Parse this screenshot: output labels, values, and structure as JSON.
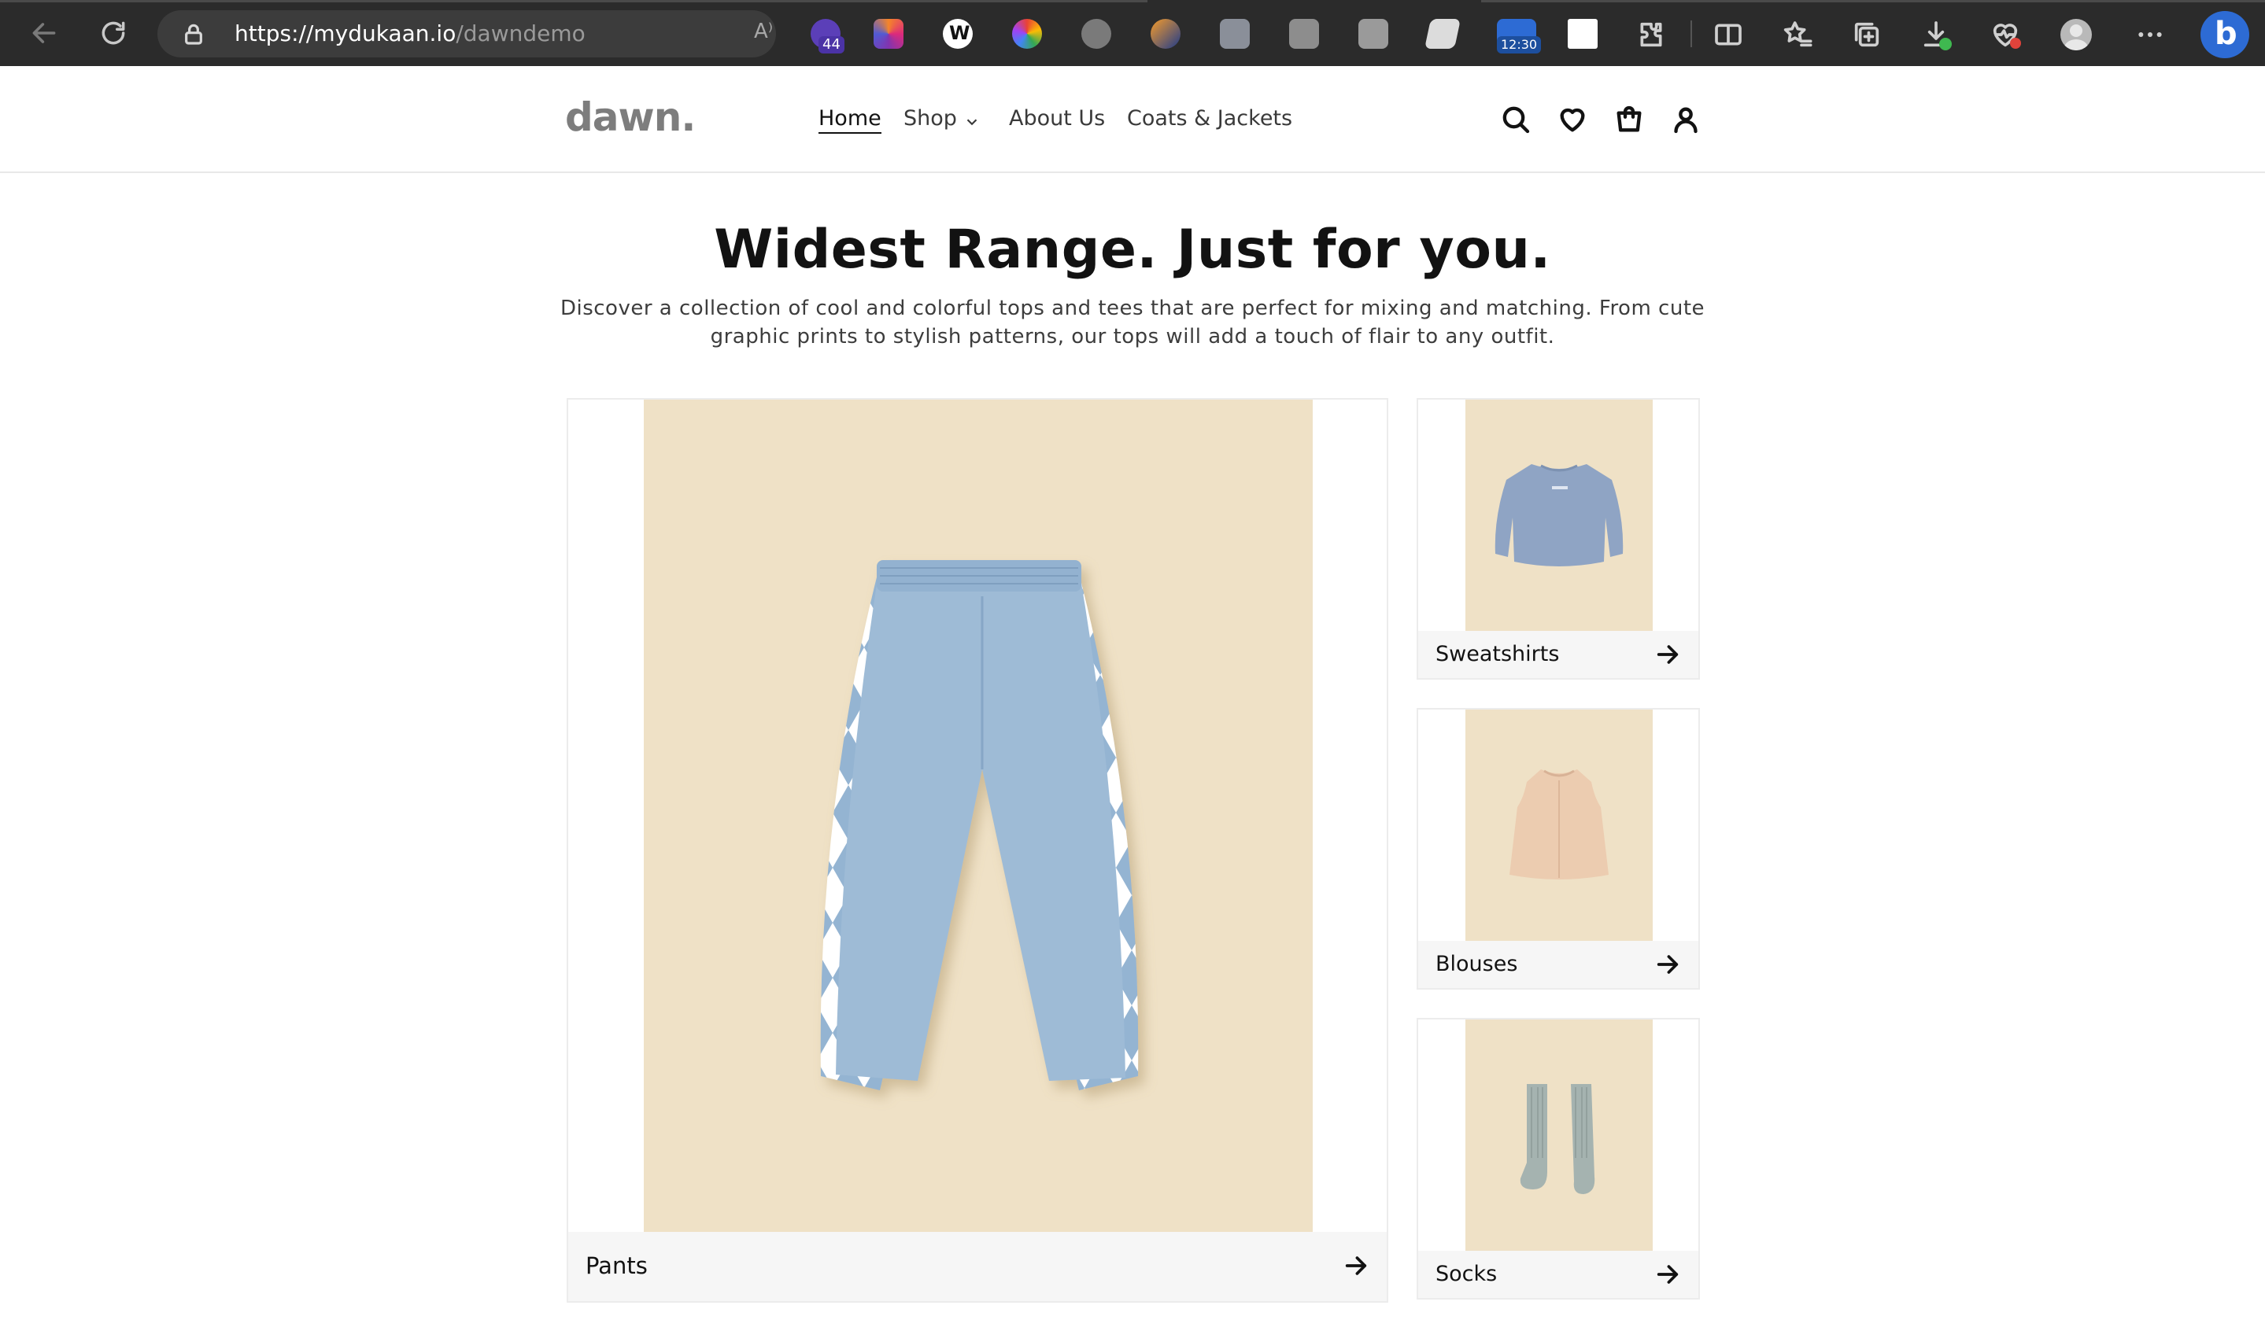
{
  "browser": {
    "url_host": "https://mydukaan.io",
    "url_path": "/dawndemo",
    "reader_label": "A⁾",
    "extension_badge_count": "44",
    "extension_clock": "12:30",
    "colors": {
      "chrome_bg": "#2b2b2b",
      "url_bg": "#3c3c3c",
      "copilot": "#2d6bd4"
    }
  },
  "header": {
    "logo": "dawn.",
    "nav": [
      {
        "label": "Home",
        "active": true
      },
      {
        "label": "Shop",
        "has_dropdown": true
      },
      {
        "label": "About Us"
      },
      {
        "label": "Coats & Jackets"
      }
    ],
    "icons": [
      "search-icon",
      "heart-icon",
      "bag-icon",
      "user-icon"
    ]
  },
  "hero": {
    "heading": "Widest Range. Just for you.",
    "subtext": "Discover a collection of cool and colorful tops and tees that are perfect for mixing and matching. From cute graphic prints to stylish patterns, our tops will add a touch of flair to any outfit."
  },
  "collections": [
    {
      "label": "Pants"
    },
    {
      "label": "Sweatshirts"
    },
    {
      "label": "Blouses"
    },
    {
      "label": "Socks"
    }
  ],
  "colors": {
    "tile_bg": "#efe1c6",
    "caption_bg": "#f6f6f6",
    "pants_blue": "#9ebbd6",
    "logo_gray": "#7d7d7d"
  }
}
